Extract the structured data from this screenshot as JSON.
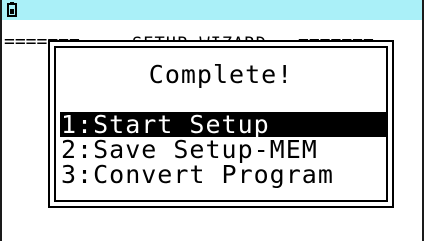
{
  "colors": {
    "status_bar": "#aaf0f8",
    "selection_background": "#000000",
    "selection_text": "#ffffff"
  },
  "status_bar": {
    "icon": "battery-icon"
  },
  "background": {
    "title": "SETUP WIZARD",
    "left_rule": "=======",
    "right_rule": "======="
  },
  "dialog": {
    "title": "Complete!",
    "menu_items": [
      {
        "label": "1:Start Setup",
        "selected": true
      },
      {
        "label": "2:Save Setup-MEM",
        "selected": false
      },
      {
        "label": "3:Convert Program",
        "selected": false
      }
    ]
  }
}
